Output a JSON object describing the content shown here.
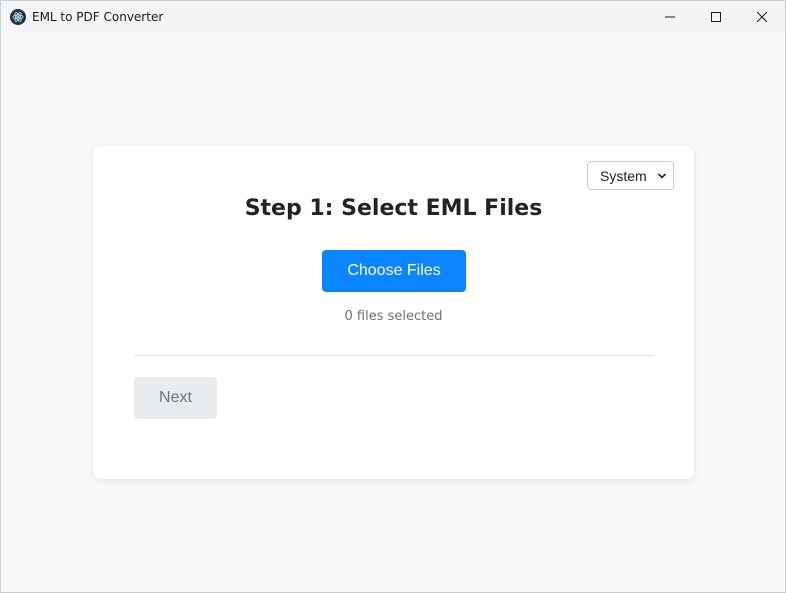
{
  "window": {
    "title": "EML to PDF Converter"
  },
  "theme_select": {
    "value": "System"
  },
  "step": {
    "heading": "Step 1: Select EML Files",
    "choose_label": "Choose Files",
    "files_count": "0 files selected",
    "next_label": "Next"
  },
  "colors": {
    "accent": "#0a84ff",
    "background": "#f7f8fa",
    "card": "#ffffff",
    "disabled_button": "#e8ebee"
  }
}
